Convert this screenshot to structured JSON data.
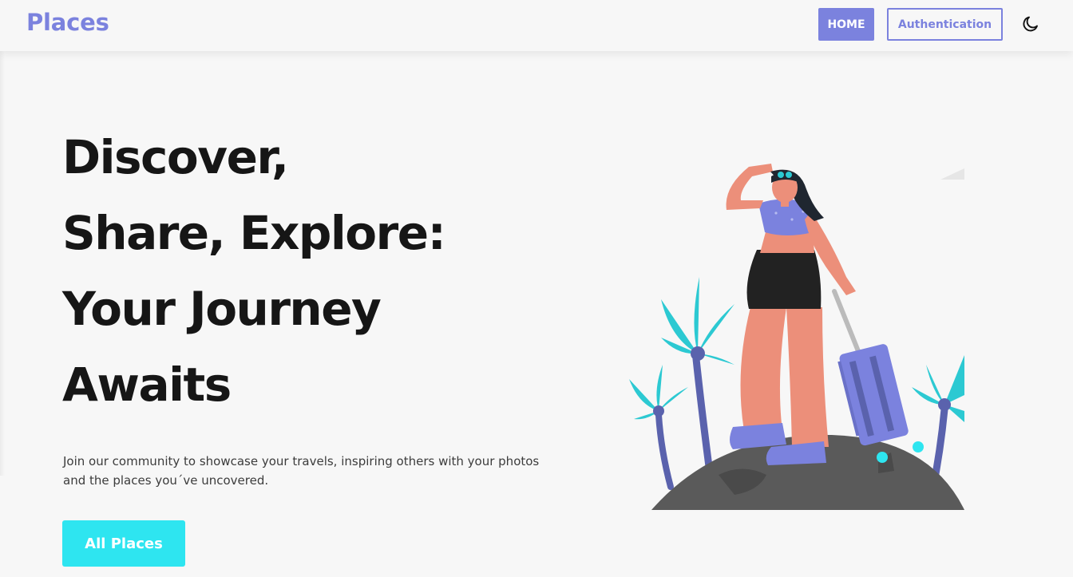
{
  "navbar": {
    "logo": "Places",
    "home_label": "HOME",
    "auth_label": "Authentication",
    "theme_icon": "moon-icon"
  },
  "hero": {
    "title_lines": [
      "Discover,",
      "Share, Explore:",
      "Your Journey",
      "Awaits"
    ],
    "description": "Join our community to showcase your travels, inspiring others with your photos and the places you´ve uncovered.",
    "cta_label": "All Places"
  },
  "illustration": {
    "name": "traveler-illustration"
  },
  "colors": {
    "accent": "#7b82de",
    "cta": "#2ee5f0",
    "background": "#f7f7f7",
    "text": "#161616"
  }
}
